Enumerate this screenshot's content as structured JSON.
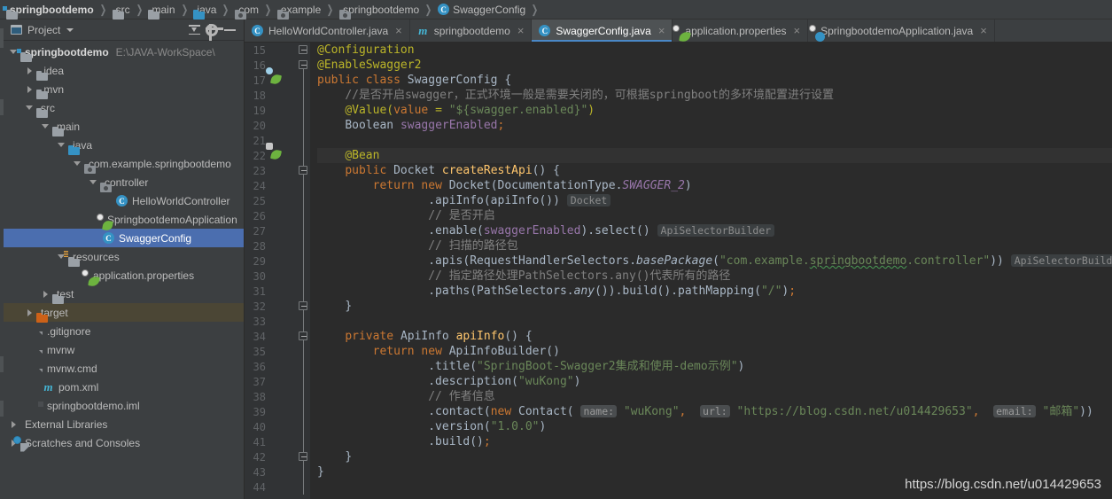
{
  "breadcrumb": [
    {
      "label": "springbootdemo",
      "icon": "module-folder-icon",
      "bold": true
    },
    {
      "label": "src",
      "icon": "folder-icon"
    },
    {
      "label": "main",
      "icon": "folder-icon"
    },
    {
      "label": "java",
      "icon": "source-folder-icon"
    },
    {
      "label": "com",
      "icon": "package-icon"
    },
    {
      "label": "example",
      "icon": "package-icon"
    },
    {
      "label": "springbootdemo",
      "icon": "package-icon"
    },
    {
      "label": "SwaggerConfig",
      "icon": "class-icon"
    }
  ],
  "project_panel": {
    "title": "Project",
    "toolbar": {
      "collapse_all": "collapse-all",
      "settings": "settings",
      "hide": "hide"
    },
    "tree": [
      {
        "label": "springbootdemo",
        "path": "E:\\JAVA-WorkSpace\\",
        "indent": 0,
        "arrow": "open",
        "icon": "module-folder-icon",
        "bold": true
      },
      {
        "label": ".idea",
        "indent": 1,
        "arrow": "closed",
        "icon": "folder-icon"
      },
      {
        "label": ".mvn",
        "indent": 1,
        "arrow": "closed",
        "icon": "folder-icon"
      },
      {
        "label": "src",
        "indent": 1,
        "arrow": "open",
        "icon": "folder-icon"
      },
      {
        "label": "main",
        "indent": 2,
        "arrow": "open",
        "icon": "folder-icon"
      },
      {
        "label": "java",
        "indent": 3,
        "arrow": "open",
        "icon": "source-folder-icon"
      },
      {
        "label": "com.example.springbootdemo",
        "indent": 4,
        "arrow": "open",
        "icon": "package-icon"
      },
      {
        "label": "controller",
        "indent": 5,
        "arrow": "open",
        "icon": "package-icon"
      },
      {
        "label": "HelloWorldController",
        "indent": 6,
        "arrow": "none",
        "icon": "class-icon"
      },
      {
        "label": "SpringbootdemoApplication",
        "indent": 5,
        "arrow": "none",
        "icon": "spring-boot-icon"
      },
      {
        "label": "SwaggerConfig",
        "indent": 5,
        "arrow": "none",
        "icon": "class-icon",
        "selected": true
      },
      {
        "label": "resources",
        "indent": 3,
        "arrow": "open",
        "icon": "resources-folder-icon"
      },
      {
        "label": "application.properties",
        "indent": 4,
        "arrow": "none",
        "icon": "spring-properties-icon"
      },
      {
        "label": "test",
        "indent": 2,
        "arrow": "closed",
        "icon": "folder-icon"
      },
      {
        "label": "target",
        "indent": 1,
        "arrow": "closed",
        "icon": "excluded-folder-icon",
        "highlighted": true
      },
      {
        "label": ".gitignore",
        "indent": 2,
        "arrow": "none",
        "icon": "text-file-icon"
      },
      {
        "label": "mvnw",
        "indent": 2,
        "arrow": "none",
        "icon": "text-file-icon"
      },
      {
        "label": "mvnw.cmd",
        "indent": 2,
        "arrow": "none",
        "icon": "text-file-icon"
      },
      {
        "label": "pom.xml",
        "indent": 2,
        "arrow": "none",
        "icon": "maven-icon"
      },
      {
        "label": "springbootdemo.iml",
        "indent": 2,
        "arrow": "none",
        "icon": "iml-file-icon"
      },
      {
        "label": "External Libraries",
        "indent": 0,
        "arrow": "closed",
        "icon": "libraries-icon"
      },
      {
        "label": "Scratches and Consoles",
        "indent": 0,
        "arrow": "closed",
        "icon": "scratches-icon"
      }
    ]
  },
  "editor_tabs": [
    {
      "label": "HelloWorldController.java",
      "icon": "class-icon",
      "active": false,
      "close": "×"
    },
    {
      "label": "springbootdemo",
      "icon": "maven-icon",
      "active": false,
      "close": "×"
    },
    {
      "label": "SwaggerConfig.java",
      "icon": "class-icon",
      "active": true,
      "close": "×"
    },
    {
      "label": "application.properties",
      "icon": "spring-properties-icon",
      "active": false,
      "close": "×"
    },
    {
      "label": "SpringbootdemoApplication.java",
      "icon": "spring-boot-icon",
      "active": false,
      "close": "×"
    }
  ],
  "editor": {
    "first_line_number": 15,
    "last_line_number": 44,
    "gutter_icons": [
      {
        "line": 17,
        "icon": "spring-bean-class-icon"
      },
      {
        "line": 22,
        "icon": "spring-bean-method-icon"
      }
    ],
    "lines": [
      {
        "n": 15,
        "text": "@Configuration"
      },
      {
        "n": 16,
        "text": "@EnableSwagger2"
      },
      {
        "n": 17,
        "text": "public class SwaggerConfig {"
      },
      {
        "n": 18,
        "text": "    //是否开启swagger，正式环境一般是需要关闭的，可根据springboot的多环境配置进行设置"
      },
      {
        "n": 19,
        "text": "    @Value(value = \"${swagger.enabled}\")"
      },
      {
        "n": 20,
        "text": "    Boolean swaggerEnabled;"
      },
      {
        "n": 21,
        "text": ""
      },
      {
        "n": 22,
        "text": "    @Bean"
      },
      {
        "n": 23,
        "text": "    public Docket createRestApi() {"
      },
      {
        "n": 24,
        "text": "        return new Docket(DocumentationType.SWAGGER_2)"
      },
      {
        "n": 25,
        "text": "                .apiInfo(apiInfo())   Docket"
      },
      {
        "n": 26,
        "text": "                // 是否开启"
      },
      {
        "n": 27,
        "text": "                .enable(swaggerEnabled).select()   ApiSelectorBuilder"
      },
      {
        "n": 28,
        "text": "                // 扫描的路径包"
      },
      {
        "n": 29,
        "text": "                .apis(RequestHandlerSelectors.basePackage(\"com.example.springbootdemo.controller\"))   ApiSelectorBuilder"
      },
      {
        "n": 30,
        "text": "                // 指定路径处理PathSelectors.any()代表所有的路径"
      },
      {
        "n": 31,
        "text": "                .paths(PathSelectors.any()).build().pathMapping(\"/\");"
      },
      {
        "n": 32,
        "text": "    }"
      },
      {
        "n": 33,
        "text": ""
      },
      {
        "n": 34,
        "text": "    private ApiInfo apiInfo() {"
      },
      {
        "n": 35,
        "text": "        return new ApiInfoBuilder()"
      },
      {
        "n": 36,
        "text": "                .title(\"SpringBoot-Swagger2集成和使用-demo示例\")"
      },
      {
        "n": 37,
        "text": "                .description(\"wuKong\")"
      },
      {
        "n": 38,
        "text": "                // 作者信息"
      },
      {
        "n": 39,
        "text": "                .contact(new Contact( name: \"wuKong\",  url: \"https://blog.csdn.net/u014429653\",  email: \"邮箱\"))"
      },
      {
        "n": 40,
        "text": "                .version(\"1.0.0\")"
      },
      {
        "n": 41,
        "text": "                .build();"
      },
      {
        "n": 42,
        "text": "    }"
      },
      {
        "n": 43,
        "text": "}"
      },
      {
        "n": 44,
        "text": ""
      }
    ],
    "param_hints": [
      "name:",
      "url:",
      "email:"
    ],
    "type_hints": [
      "Docket",
      "ApiSelectorBuilder",
      "ApiSelectorBuilder"
    ]
  },
  "watermark": "https://blog.csdn.net/u014429653",
  "colors": {
    "editor_bg": "#2b2b2b",
    "panel_bg": "#3c3f41",
    "gutter_bg": "#313335",
    "selection": "#4b6eaf",
    "keyword": "#cc7832",
    "annotation": "#bbb529",
    "string": "#6a8759",
    "comment": "#808080",
    "method": "#ffc66d",
    "field": "#9876aa",
    "default_text": "#a9b7c6",
    "tab_underline": "#4a88c7"
  }
}
